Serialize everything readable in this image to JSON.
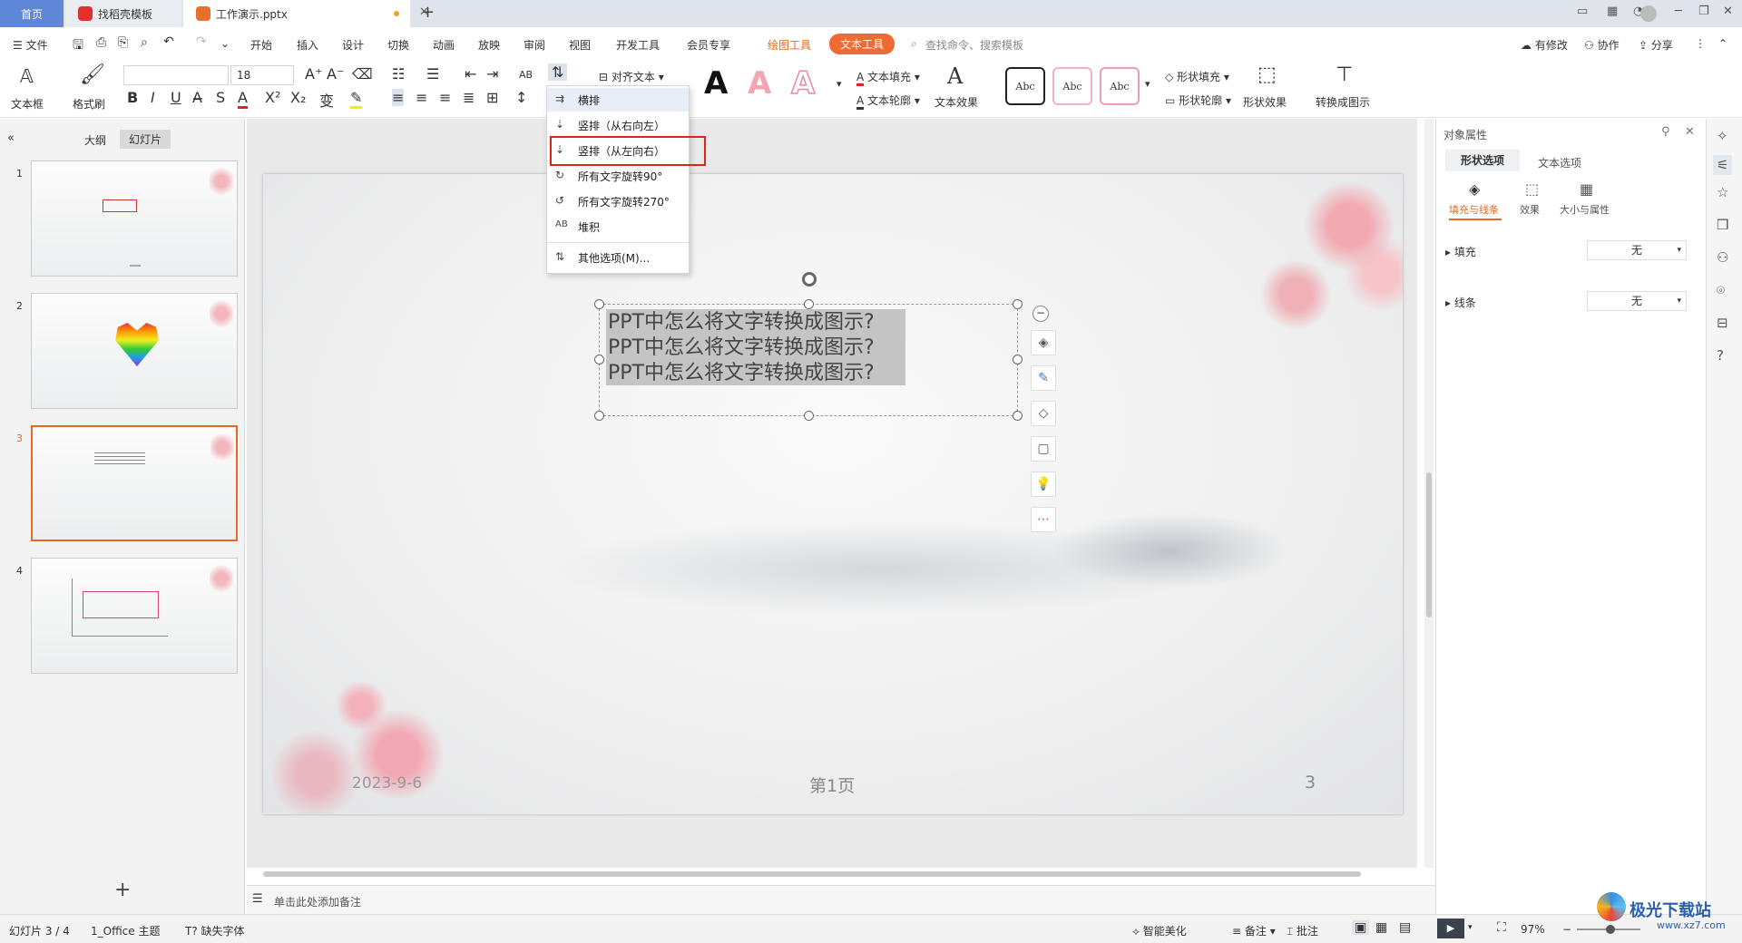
{
  "tabs": {
    "home": "首页",
    "template": "找稻壳模板",
    "file": "工作演示.pptx",
    "new_tab": "+"
  },
  "menu": {
    "file": "文件",
    "items": [
      "开始",
      "插入",
      "设计",
      "切换",
      "动画",
      "放映",
      "审阅",
      "视图",
      "开发工具",
      "会员专享"
    ],
    "drawing_tools": "绘图工具",
    "text_tools": "文本工具",
    "search_placeholder": "查找命令、搜索模板",
    "modified": "有修改",
    "collab": "协作",
    "share": "分享"
  },
  "ribbon": {
    "textbox": "文本框",
    "format_painter": "格式刷",
    "font_size": "18",
    "align_text": "对齐文本",
    "text_fill": "文本填充",
    "text_outline": "文本轮廓",
    "text_effect": "文本效果",
    "style_sample": "Abc",
    "shape_fill": "形状填充",
    "shape_outline": "形状轮廓",
    "shape_effect": "形状效果",
    "convert_diagram": "转换成图示"
  },
  "dropdown": {
    "items": [
      "横排",
      "竖排（从右向左）",
      "竖排（从左向右）",
      "所有文字旋转90°",
      "所有文字旋转270°",
      "堆积",
      "其他选项(M)..."
    ],
    "selected_index": 2
  },
  "left_panel": {
    "tab_outline": "大纲",
    "tab_slides": "幻灯片",
    "slide_numbers": [
      "1",
      "2",
      "3",
      "4"
    ],
    "add": "+"
  },
  "slide": {
    "lines": [
      "PPT中怎么将文字转换成图示?",
      "PPT中怎么将文字转换成图示?",
      "PPT中怎么将文字转换成图示?"
    ],
    "date": "2023-9-6",
    "page_label": "第1页",
    "page_number": "3"
  },
  "notes_placeholder": "单击此处添加备注",
  "right_panel": {
    "title": "对象属性",
    "tab_shape": "形状选项",
    "tab_text": "文本选项",
    "sub_fill_line": "填充与线条",
    "sub_effect": "效果",
    "sub_size": "大小与属性",
    "fill_label": "填充",
    "fill_value": "无",
    "line_label": "线条",
    "line_value": "无"
  },
  "status": {
    "slide_info": "幻灯片 3 / 4",
    "theme": "1_Office 主题",
    "missing_font": "缺失字体",
    "smart_beautify": "智能美化",
    "notes": "备注",
    "comments": "批注",
    "zoom": "97%"
  },
  "watermark": "极光下载站",
  "watermark_url": "www.xz7.com",
  "colors": {
    "accent": "#e26b21",
    "home_tab": "#5e87d7",
    "highlight_box": "#d9261c",
    "text_tools_tab": "#ef6b34"
  }
}
